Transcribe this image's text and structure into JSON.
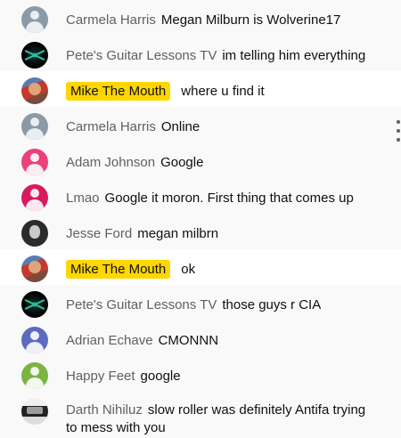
{
  "colors": {
    "background": "#f9f9f9",
    "owner_badge": "#ffd600",
    "author_text": "#606060",
    "message_text": "#0f0f0f"
  },
  "messages": [
    {
      "author": "Carmela Harris",
      "text": "Megan Milburn is Wolverine17",
      "avatar": "default-person-icon"
    },
    {
      "author": "Pete's Guitar Lessons TV",
      "text": "im telling him everything",
      "avatar": "guitar-channel-avatar"
    },
    {
      "author": "Mike The Mouth",
      "text": "where u find it",
      "avatar": "mike-avatar",
      "owner": true
    },
    {
      "author": "Carmela Harris",
      "text": "Online",
      "avatar": "default-person-icon"
    },
    {
      "author": "Adam Johnson",
      "text": "Google",
      "avatar": "default-person-icon"
    },
    {
      "author": "Lmao",
      "text": "Google it moron. First thing that comes up",
      "avatar": "default-person-icon"
    },
    {
      "author": "Jesse Ford",
      "text": "megan milbrn",
      "avatar": "jesse-avatar"
    },
    {
      "author": "Mike The Mouth",
      "text": "ok",
      "avatar": "mike-avatar",
      "owner": true
    },
    {
      "author": "Pete's Guitar Lessons TV",
      "text": "those guys r CIA",
      "avatar": "guitar-channel-avatar"
    },
    {
      "author": "Adrian Echave",
      "text": "CMONNN",
      "avatar": "default-person-icon"
    },
    {
      "author": "Happy Feet",
      "text": "google",
      "avatar": "default-person-icon"
    },
    {
      "author": "Darth Nihiluz",
      "text": "slow roller was definitely Antifa trying to mess with you",
      "avatar": "darth-avatar"
    }
  ]
}
